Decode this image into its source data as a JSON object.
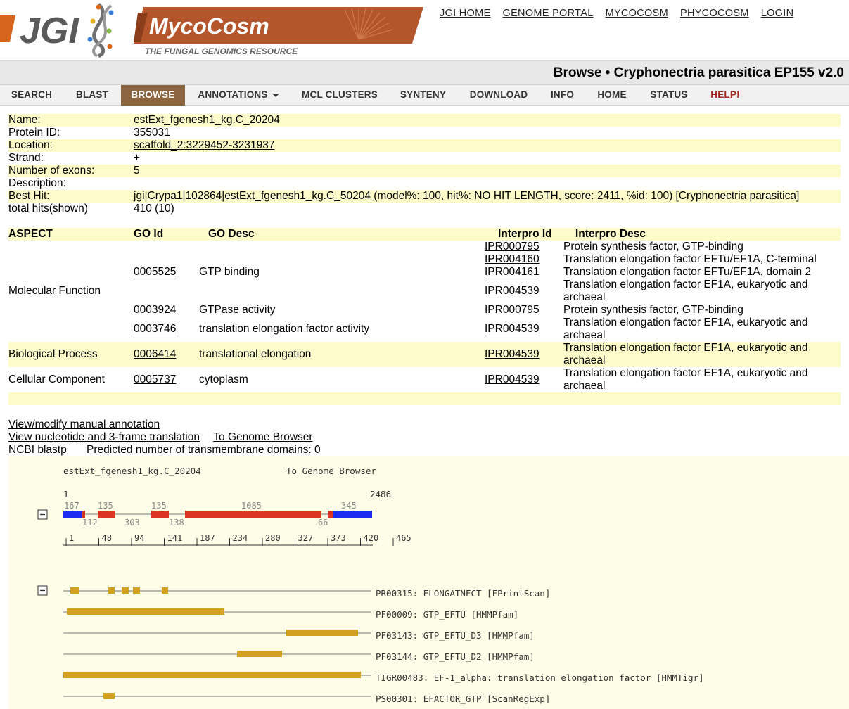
{
  "header": {
    "jgi_logo_text": "JGI",
    "myco_logo_title": "MycoCosm",
    "myco_logo_subtitle": "THE FUNGAL GENOMICS RESOURCE",
    "top_links": [
      "JGI HOME",
      "GENOME PORTAL",
      "MYCOCOSM",
      "PHYCOCOSM",
      "LOGIN"
    ]
  },
  "title": "Browse • Cryphonectria parasitica EP155 v2.0",
  "nav": {
    "items": [
      "SEARCH",
      "BLAST",
      "BROWSE",
      "ANNOTATIONS",
      "MCL CLUSTERS",
      "SYNTENY",
      "DOWNLOAD",
      "INFO",
      "HOME",
      "STATUS",
      "HELP!"
    ],
    "active": "BROWSE"
  },
  "info": {
    "name_label": "Name:",
    "name": "estExt_fgenesh1_kg.C_20204",
    "protein_label": "Protein ID:",
    "protein": "355031",
    "location_label": "Location:",
    "location": "scaffold_2:3229452-3231937",
    "strand_label": "Strand:",
    "strand": "+",
    "exons_label": "Number of exons:",
    "exons": "5",
    "description_label": "Description:",
    "description": "",
    "besthit_label": "Best Hit:",
    "besthit_link": "jgi|Crypa1|102864|estExt_fgenesh1_kg.C_50204 ",
    "besthit_rest": "(model%: 100, hit%: NO HIT LENGTH, score: 2411, %id: 100) [Cryphonectria parasitica]",
    "hits_label": "total hits(shown)",
    "hits": "410 (10)"
  },
  "go": {
    "headers": {
      "aspect": "ASPECT",
      "go_id": "GO Id",
      "go_desc": "GO Desc",
      "ipr_id": "Interpro Id",
      "ipr_desc": "Interpro Desc"
    },
    "mf_aspect": "Molecular Function",
    "mf_go1_id": "0005525",
    "mf_go1_desc": "GTP binding",
    "mf_go2_id": "0003924",
    "mf_go2_desc": "GTPase activity",
    "mf_go3_id": "0003746",
    "mf_go3_desc": "translation elongation factor activity",
    "ipr_a": "IPR000795",
    "ipr_a_desc": "Protein synthesis factor, GTP-binding",
    "ipr_b": "IPR004160",
    "ipr_b_desc": "Translation elongation factor EFTu/EF1A, C-terminal",
    "ipr_c": "IPR004161",
    "ipr_c_desc": "Translation elongation factor EFTu/EF1A, domain 2",
    "ipr_d": "IPR004539",
    "ipr_d_desc1": "Translation elongation factor EF1A, eukaryotic and",
    "ipr_d_desc2": "archaeal",
    "bp_aspect": "Biological Process",
    "bp_go_id": "0006414",
    "bp_go_desc": "translational elongation",
    "cc_aspect": "Cellular Component",
    "cc_go_id": "0005737",
    "cc_go_desc": "cytoplasm"
  },
  "links": {
    "view_modify": "View/modify manual annotation",
    "view_nucleotide": "View nucleotide and 3-frame translation",
    "to_genome_browser": "To Genome Browser",
    "ncbi_blastp": "NCBI blastp",
    "tm_domains": "Predicted number of transmembrane domains: 0"
  },
  "graphic": {
    "gene_name": "estExt_fgenesh1_kg.C_20204",
    "genome_browser_link": "To Genome Browser",
    "start": "1",
    "end": "2486",
    "collapse_symbol": "−",
    "upper_labels": [
      "167",
      "135",
      "135",
      "1085",
      "345"
    ],
    "lower_labels": [
      "112",
      "303",
      "138",
      "66"
    ],
    "ruler_labels": [
      "1",
      "48",
      "94",
      "141",
      "187",
      "234",
      "280",
      "327",
      "373",
      "420",
      "465"
    ],
    "colors": {
      "utr": "#1e2bf0",
      "exon": "#dd3524",
      "domain": "#d4a020",
      "line": "#777777"
    },
    "domains": [
      "PR00315: ELONGATNFCT [FPrintScan]",
      "PF00009: GTP_EFTU [HMMPfam]",
      "PF03143: GTP_EFTU_D3 [HMMPfam]",
      "PF03144: GTP_EFTU_D2 [HMMPfam]",
      "TIGR00483: EF-1_alpha: translation elongation factor [HMMTigr]",
      "PS00301: EFACTOR_GTP [ScanRegExp]"
    ]
  }
}
